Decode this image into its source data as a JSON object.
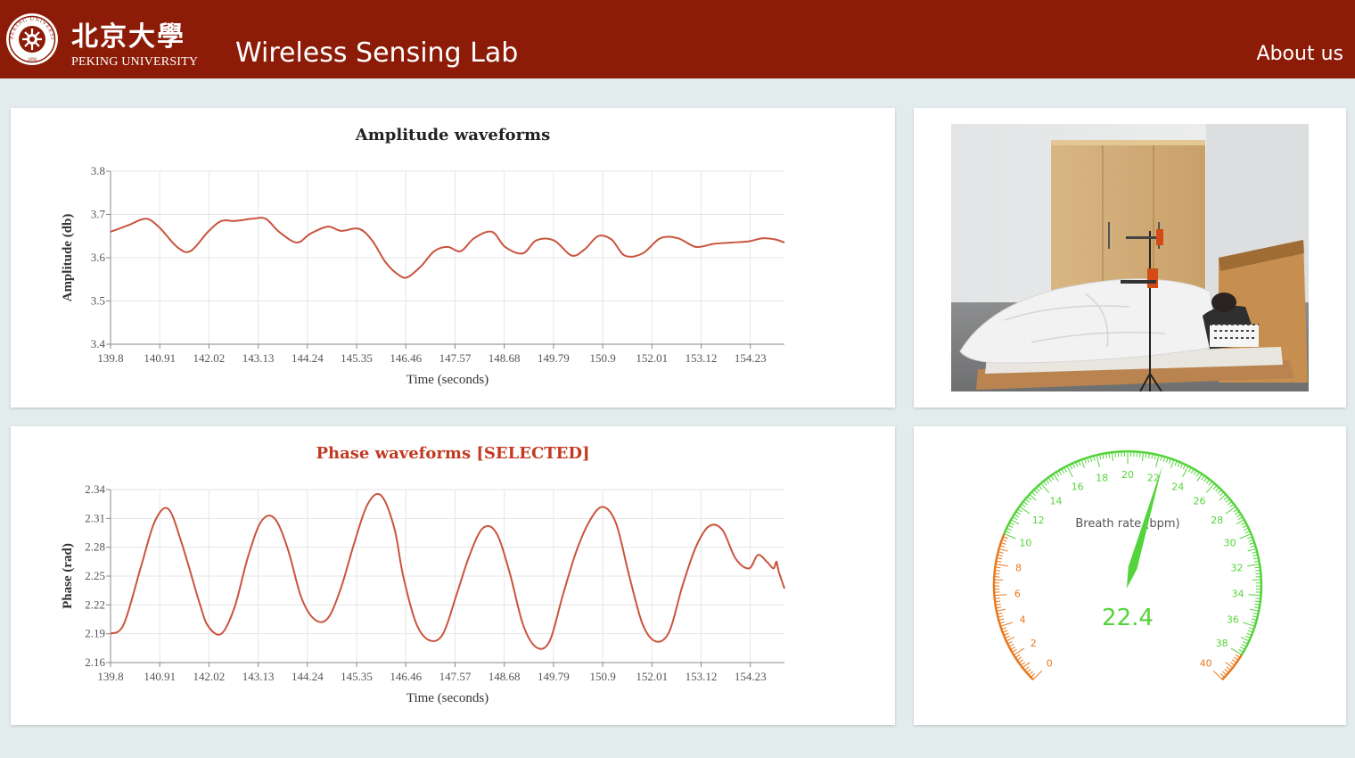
{
  "header": {
    "logo_cn": "北京大學",
    "logo_en": "PEKING UNIVERSITY",
    "seal_text": "PEKING UNIVERSITY",
    "seal_year": "1898",
    "title": "Wireless Sensing Lab",
    "about_label": "About us"
  },
  "colors": {
    "header_bg": "#8c1c08",
    "line": "#c9543e",
    "selected_title": "#c23a22",
    "gauge_green": "#53d43a",
    "gauge_orange": "#e8781e"
  },
  "chart_data": [
    {
      "type": "line",
      "title": "Amplitude waveforms",
      "xlabel": "Time (seconds)",
      "ylabel": "Amplitude (db)",
      "xlim": [
        139.8,
        155.0
      ],
      "ylim": [
        3.4,
        3.8
      ],
      "xticks": [
        139.8,
        140.91,
        142.02,
        143.13,
        144.24,
        145.35,
        146.46,
        147.57,
        148.68,
        149.79,
        150.9,
        152.01,
        153.12,
        154.23
      ],
      "yticks": [
        3.4,
        3.5,
        3.6,
        3.7,
        3.8
      ],
      "grid": true,
      "series": [
        {
          "x": [
            139.8,
            140.2,
            140.6,
            140.9,
            141.3,
            141.6,
            142.0,
            142.3,
            142.6,
            143.0,
            143.3,
            143.6,
            144.0,
            144.3,
            144.7,
            145.0,
            145.4,
            145.7,
            146.0,
            146.3,
            146.5,
            146.8,
            147.1,
            147.4,
            147.7,
            148.0,
            148.4,
            148.7,
            149.1,
            149.4,
            149.8,
            150.2,
            150.5,
            150.8,
            151.1,
            151.4,
            151.8,
            152.2,
            152.6,
            153.0,
            153.4,
            153.8,
            154.2,
            154.5,
            154.8,
            155.0
          ],
          "y": [
            3.66,
            3.675,
            3.69,
            3.67,
            3.625,
            3.615,
            3.66,
            3.685,
            3.685,
            3.69,
            3.69,
            3.66,
            3.635,
            3.655,
            3.672,
            3.662,
            3.667,
            3.64,
            3.59,
            3.56,
            3.555,
            3.58,
            3.615,
            3.625,
            3.615,
            3.645,
            3.66,
            3.625,
            3.61,
            3.64,
            3.64,
            3.605,
            3.62,
            3.65,
            3.642,
            3.605,
            3.61,
            3.645,
            3.645,
            3.625,
            3.632,
            3.635,
            3.638,
            3.645,
            3.642,
            3.635
          ]
        }
      ]
    },
    {
      "type": "line",
      "title": "Phase waveforms [SELECTED]",
      "xlabel": "Time (seconds)",
      "ylabel": "Phase (rad)",
      "xlim": [
        139.8,
        155.0
      ],
      "ylim": [
        2.16,
        2.34
      ],
      "xticks": [
        139.8,
        140.91,
        142.02,
        143.13,
        144.24,
        145.35,
        146.46,
        147.57,
        148.68,
        149.79,
        150.9,
        152.01,
        153.12,
        154.23
      ],
      "yticks": [
        2.16,
        2.19,
        2.22,
        2.25,
        2.28,
        2.31,
        2.34
      ],
      "grid": true,
      "series": [
        {
          "x": [
            139.8,
            140.1,
            140.5,
            140.8,
            141.1,
            141.4,
            141.8,
            142.0,
            142.3,
            142.6,
            142.9,
            143.2,
            143.5,
            143.8,
            144.1,
            144.4,
            144.7,
            145.0,
            145.3,
            145.6,
            145.9,
            146.2,
            146.4,
            146.7,
            147.0,
            147.3,
            147.6,
            147.9,
            148.2,
            148.5,
            148.8,
            149.1,
            149.4,
            149.7,
            150.0,
            150.3,
            150.6,
            150.9,
            151.2,
            151.5,
            151.8,
            152.1,
            152.4,
            152.7,
            153.0,
            153.3,
            153.6,
            153.9,
            154.2,
            154.4,
            154.6,
            154.75,
            154.82,
            154.87,
            155.0
          ],
          "y": [
            2.19,
            2.2,
            2.262,
            2.307,
            2.32,
            2.285,
            2.223,
            2.198,
            2.19,
            2.218,
            2.27,
            2.307,
            2.31,
            2.278,
            2.228,
            2.205,
            2.206,
            2.238,
            2.285,
            2.325,
            2.334,
            2.3,
            2.25,
            2.2,
            2.183,
            2.19,
            2.23,
            2.272,
            2.3,
            2.295,
            2.254,
            2.2,
            2.176,
            2.182,
            2.23,
            2.275,
            2.307,
            2.322,
            2.305,
            2.25,
            2.2,
            2.182,
            2.192,
            2.24,
            2.28,
            2.302,
            2.298,
            2.268,
            2.258,
            2.272,
            2.265,
            2.258,
            2.265,
            2.255,
            2.237
          ]
        }
      ]
    },
    {
      "type": "gauge",
      "label": "Breath rate (bpm)",
      "value": 22.4,
      "display_value": "22.4",
      "range": [
        0,
        40
      ],
      "tick_labels": [
        0,
        2,
        4,
        6,
        8,
        10,
        12,
        14,
        16,
        18,
        20,
        22,
        24,
        26,
        28,
        30,
        32,
        34,
        36,
        38,
        40
      ],
      "orange_below": 10,
      "orange_above": 38
    }
  ],
  "photo": {
    "alt": "Person sleeping in bed with wireless sensing device on tripod"
  }
}
